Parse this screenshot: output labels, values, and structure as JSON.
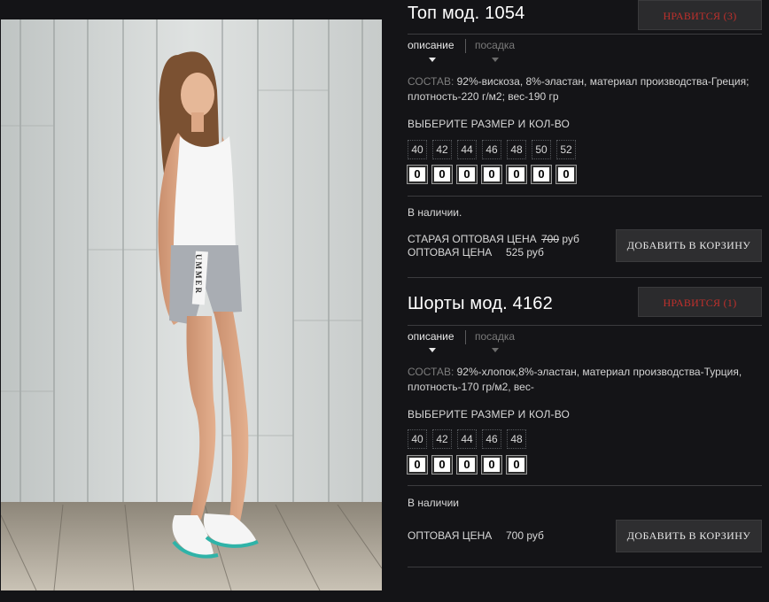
{
  "products": [
    {
      "title": "Топ мод. 1054",
      "like_label": "НРАВИТСЯ (3)",
      "tab_active": "описание",
      "tab_inactive": "посадка",
      "composition_label": "СОСТАВ:",
      "composition_text": "92%-вискоза, 8%-эластан, материал производства-Греция; плотность-220 г/м2; вес-190 гр",
      "size_heading": "ВЫБЕРИТЕ РАЗМЕР И КОЛ-ВО",
      "sizes": [
        "40",
        "42",
        "44",
        "46",
        "48",
        "50",
        "52"
      ],
      "quantities": [
        "0",
        "0",
        "0",
        "0",
        "0",
        "0",
        "0"
      ],
      "stock": "В наличии.",
      "old_price_label": "СТАРАЯ ОПТОВАЯ ЦЕНА",
      "old_price_value": "700",
      "old_price_currency": "руб",
      "price_label": "ОПТОВАЯ ЦЕНА",
      "price_value": "525 руб",
      "cart_label": "ДОБАВИТЬ В КОРЗИНУ"
    },
    {
      "title": "Шорты мод. 4162",
      "like_label": "НРАВИТСЯ (1)",
      "tab_active": "описание",
      "tab_inactive": "посадка",
      "composition_label": "СОСТАВ:",
      "composition_text": "92%-хлопок,8%-эластан, материал производства-Турция, плотность-170 гр/м2, вес-",
      "size_heading": "ВЫБЕРИТЕ РАЗМЕР И КОЛ-ВО",
      "sizes": [
        "40",
        "42",
        "44",
        "46",
        "48"
      ],
      "quantities": [
        "0",
        "0",
        "0",
        "0",
        "0"
      ],
      "stock": "В наличии",
      "price_label": "ОПТОВАЯ ЦЕНА",
      "price_value": "700 руб",
      "cart_label": "ДОБАВИТЬ В КОРЗИНУ"
    }
  ],
  "photo": {
    "shorts_print": "UMMER"
  },
  "colors": {
    "background": "#141417",
    "like_text": "#c0302c",
    "button_bg": "#2e2e30"
  }
}
